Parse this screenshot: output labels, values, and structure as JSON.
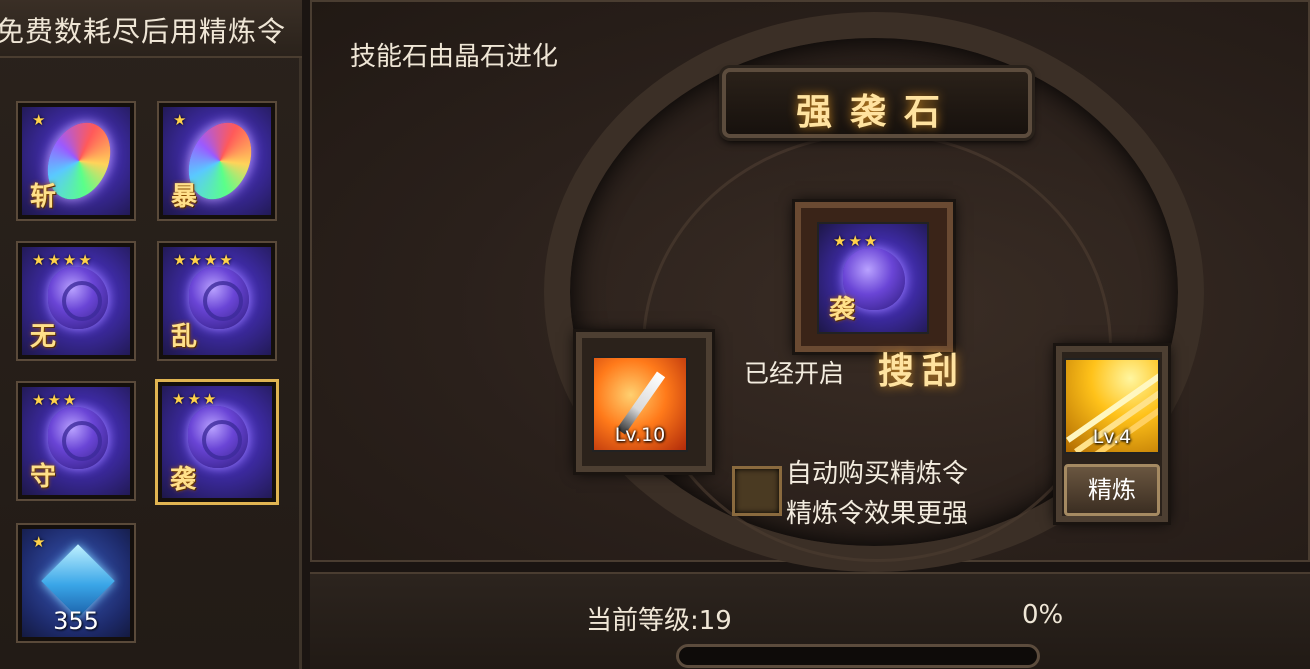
{
  "left_panel": {
    "header": "免费数耗尽后用精炼令",
    "slots": [
      {
        "stars": "★",
        "glyph": "斩",
        "icon": "rainbow-gem-icon",
        "selected": false
      },
      {
        "stars": "★",
        "glyph": "暴",
        "icon": "rainbow-gem-icon",
        "selected": false
      },
      {
        "stars": "★★★★",
        "glyph": "无",
        "icon": "purple-stone-icon",
        "selected": false
      },
      {
        "stars": "★★★★",
        "glyph": "乱",
        "icon": "purple-stone-icon",
        "selected": false
      },
      {
        "stars": "★★★",
        "glyph": "守",
        "icon": "purple-stone-icon",
        "selected": false
      },
      {
        "stars": "★★★",
        "glyph": "袭",
        "icon": "purple-stone-icon",
        "selected": true
      },
      {
        "stars": "★",
        "count": "355",
        "icon": "blue-crystal-icon",
        "selected": false
      }
    ]
  },
  "main": {
    "hint": "技能石由晶石进化",
    "title": "强袭石",
    "center_stone": {
      "stars": "★★★",
      "glyph": "袭",
      "icon": "purple-stone-icon"
    },
    "opened_label": "已经开启",
    "opened_skill": "搜刮",
    "left_skill": {
      "icon": "sword-skill-icon",
      "level": "Lv.10"
    },
    "right_skill": {
      "icon": "burst-skill-icon",
      "level": "Lv.4"
    },
    "auto_buy_line1": "自动购买精炼令",
    "auto_buy_line2": "精炼令效果更强",
    "auto_buy_checked": false,
    "refine_button": "精炼"
  },
  "bottom": {
    "level_text": "当前等级:19",
    "percent_text": "0%",
    "progress": 0
  },
  "colors": {
    "accent_gold": "#ffe3a0",
    "panel_bg": "#2a201b",
    "selected_border": "#e0b452"
  }
}
